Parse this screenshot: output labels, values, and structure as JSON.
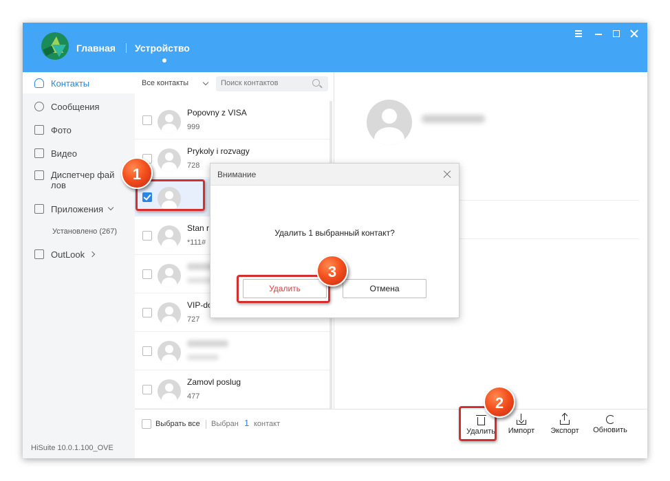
{
  "app": {
    "nav_home": "Главная",
    "nav_device": "Устройство",
    "version": "HiSuite 10.0.1.100_OVE"
  },
  "sidebar": {
    "items": [
      {
        "label": "Контакты",
        "icon": "contact-icon",
        "active": true
      },
      {
        "label": "Сообщения",
        "icon": "message-icon"
      },
      {
        "label": "Фото",
        "icon": "photo-icon"
      },
      {
        "label": "Видео",
        "icon": "video-icon"
      },
      {
        "label": "Диспетчер фай\nлов",
        "icon": "folder-icon"
      },
      {
        "label": "Приложения",
        "icon": "apps-icon"
      },
      {
        "label": "Установлено (267)"
      },
      {
        "label": "OutLook",
        "icon": "mail-icon"
      }
    ]
  },
  "contacts": {
    "filter": "Все контакты",
    "search_placeholder": "Поиск контактов",
    "rows": [
      {
        "name": "Popovny z VISA",
        "number": "999"
      },
      {
        "name": "Prykoly i rozvagy",
        "number": "728"
      },
      {
        "name": "",
        "number": "",
        "selected": true
      },
      {
        "name": "Stan r",
        "number": "*111#"
      },
      {
        "name": "",
        "number": ""
      },
      {
        "name": "VIP-do",
        "number": "727"
      },
      {
        "name": "",
        "number": ""
      },
      {
        "name": "Zamovl poslug",
        "number": "477"
      }
    ],
    "footer": {
      "select_all": "Выбрать все",
      "selected_prefix": "Выбран",
      "selected_count": "1",
      "selected_unit": "контакт"
    }
  },
  "toolbar": {
    "delete": "Удалить",
    "import": "Импорт",
    "export": "Экспорт",
    "refresh": "Обновить"
  },
  "dialog": {
    "title": "Внимание",
    "message": "Удалить 1 выбранный контакт?",
    "confirm": "Удалить",
    "cancel": "Отмена"
  },
  "badges": [
    "1",
    "2",
    "3"
  ],
  "colors": {
    "header": "#42a5f5",
    "accent": "#2a86e0",
    "highlight": "#d32f2f",
    "badge": "#f4511e"
  }
}
